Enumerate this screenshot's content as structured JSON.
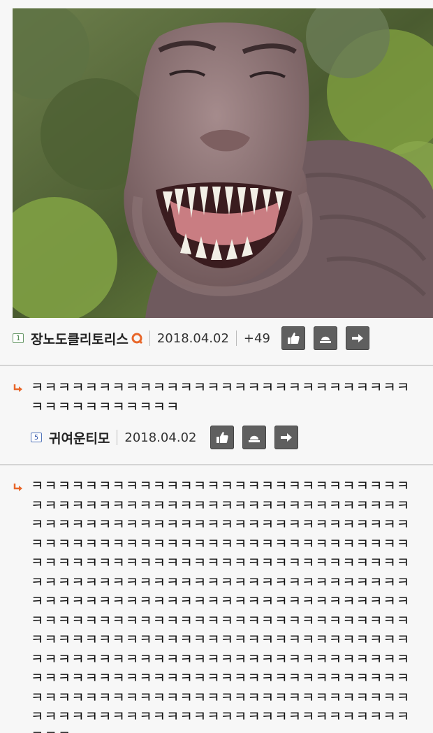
{
  "post": {
    "image": {
      "subject": "dinosaur-with-face"
    },
    "author": {
      "level": "1",
      "nickname": "장노도클리토리스"
    },
    "date": "2018.04.02",
    "score": "+49"
  },
  "comments": [
    {
      "text": "ㅋㅋㅋㅋㅋㅋㅋㅋㅋㅋㅋㅋㅋㅋㅋㅋㅋㅋㅋㅋㅋㅋㅋㅋㅋㅋㅋㅋㅋㅋㅋㅋㅋㅋㅋㅋㅋㅋㅋ",
      "author": {
        "level": "5",
        "nickname": "귀여운티모"
      },
      "date": "2018.04.02"
    },
    {
      "text": "ㅋㅋㅋㅋㅋㅋㅋㅋㅋㅋㅋㅋㅋㅋㅋㅋㅋㅋㅋㅋㅋㅋㅋㅋㅋㅋㅋㅋㅋㅋㅋㅋㅋㅋㅋㅋㅋㅋㅋㅋㅋㅋㅋㅋㅋㅋㅋㅋㅋㅋㅋㅋㅋㅋㅋㅋㅋㅋㅋㅋㅋㅋㅋㅋㅋㅋㅋㅋㅋㅋㅋㅋㅋㅋㅋㅋㅋㅋㅋㅋㅋㅋㅋㅋㅋㅋㅋㅋㅋㅋㅋㅋㅋㅋㅋㅋㅋㅋㅋㅋㅋㅋㅋㅋㅋㅋㅋㅋㅋㅋㅋㅋㅋㅋㅋㅋㅋㅋㅋㅋㅋㅋㅋㅋㅋㅋㅋㅋㅋㅋㅋㅋㅋㅋㅋㅋㅋㅋㅋㅋㅋㅋㅋㅋㅋㅋㅋㅋㅋㅋㅋㅋㅋㅋㅋㅋㅋㅋㅋㅋㅋㅋㅋㅋㅋㅋㅋㅋㅋㅋㅋㅋㅋㅋㅋㅋㅋㅋㅋㅋㅋㅋㅋㅋㅋㅋㅋㅋㅋㅋㅋㅋㅋㅋㅋㅋㅋㅋㅋㅋㅋㅋㅋㅋㅋㅋㅋㅋㅋㅋㅋㅋㅋㅋㅋㅋㅋㅋㅋㅋㅋㅋㅋㅋㅋㅋㅋㅋㅋㅋㅋㅋㅋㅋㅋㅋㅋㅋㅋㅋㅋㅋㅋㅋㅋㅋㅋㅋㅋㅋㅋㅋㅋㅋㅋㅋㅋㅋㅋㅋㅋㅋㅋㅋㅋㅋㅋㅋㅋㅋㅋㅋㅋㅋㅋㅋㅋㅋㅋㅋㅋㅋㅋㅋㅋㅋㅋㅋㅋㅋㅋㅋㅋㅋㅋㅋㅋㅋㅋㅋㅋㅋㅋㅋㅋㅋㅋㅋㅋㅋㅋㅋㅋㅋㅋㅋㅋㅋㅋㅋㅋㅋㅋㅋㅋㅋㅋㅋㅋㅋㅋㅋㅋㅋㅋㅋㅋㅋㅋㅋㅋㅋㅋㅋㅋㅋㅋㅋㅋㅋㅋㅋㅋㅋㅋㅋㅋㅋㅋㅋㅋㅋㅋㅋㅋㅋㅋ"
    }
  ],
  "icons": {
    "like": "thumbs-up-icon",
    "report": "siren-icon",
    "share": "arrow-right-icon",
    "reply": "reply-arrow-icon",
    "badge": "ring-badge-icon"
  },
  "colors": {
    "accent": "#e8672a",
    "button": "#5f5f5f",
    "level_green": "#3a7a3a",
    "level_blue": "#3355aa"
  }
}
